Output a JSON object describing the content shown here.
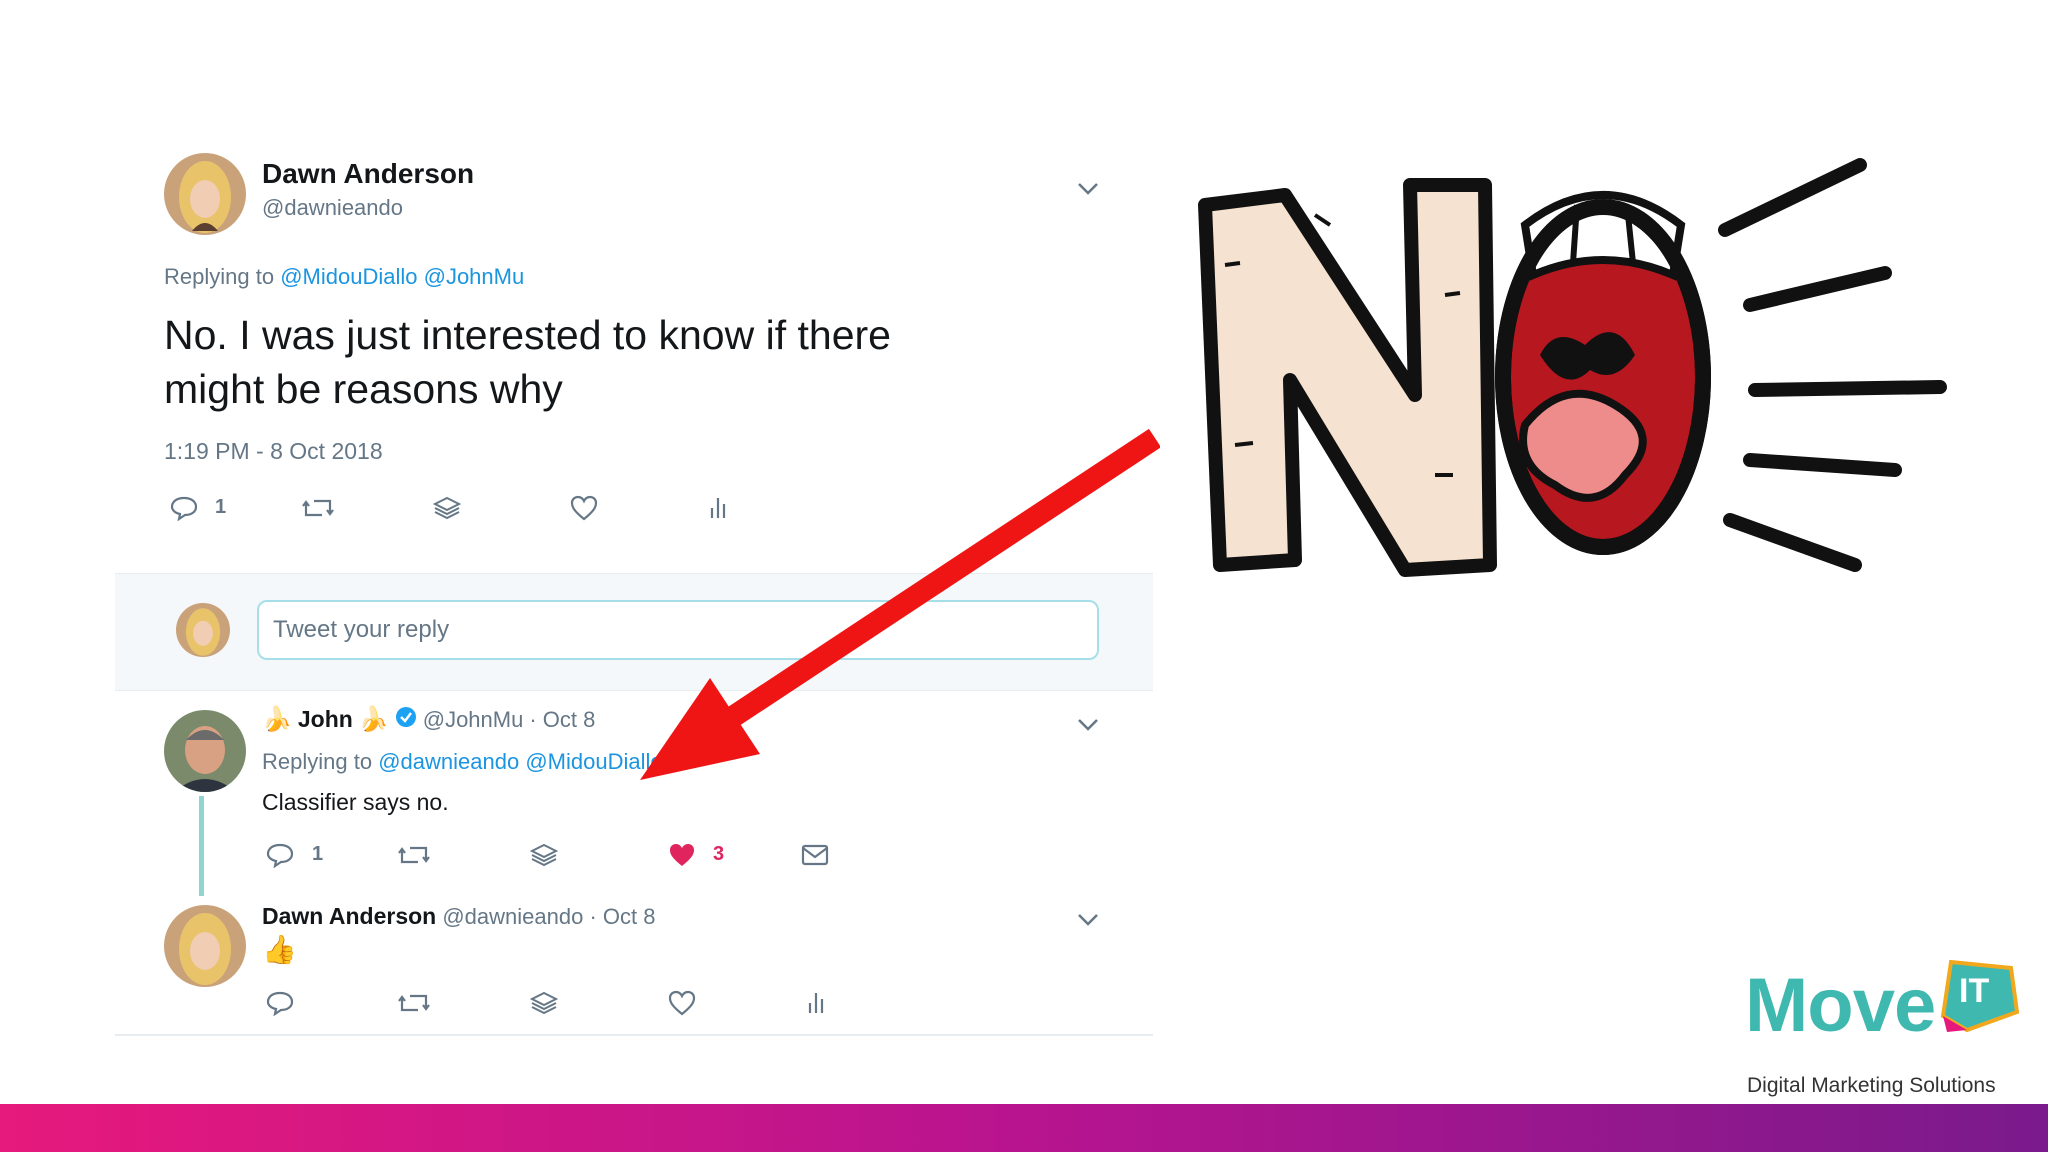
{
  "main_tweet": {
    "name": "Dawn Anderson",
    "handle": "@dawnieando",
    "replying_label": "Replying to",
    "replying_to_1": "@MidouDiallo",
    "replying_to_2": "@JohnMu",
    "text_line1": "No.  I was just interested to know if there",
    "text_line2": "might be reasons why",
    "timestamp": "1:19 PM - 8 Oct 2018",
    "reply_count": "1"
  },
  "reply_input": {
    "placeholder": "Tweet your reply"
  },
  "reply1": {
    "name": "John",
    "handle": "@JohnMu",
    "date": "· Oct 8",
    "replying_label": "Replying to",
    "replying_to_1": "@dawnieando",
    "replying_to_2": "@MidouDiallo",
    "text": "Classifier says no.",
    "reply_count": "1",
    "like_count": "3"
  },
  "reply2": {
    "name": "Dawn Anderson",
    "handle": "@dawnieando",
    "date": "· Oct 8",
    "emoji": "👍"
  },
  "logo": {
    "word": "Move",
    "badge": "IT",
    "tagline": "Digital Marketing Solutions"
  },
  "graphic": {
    "text": "NO"
  },
  "colors": {
    "link": "#1b95e0",
    "like": "#e0245e",
    "arrow": "#f01515",
    "logo_teal": "#3fb8b0",
    "bar_start": "#e6197c",
    "bar_end": "#7a1a8c"
  }
}
